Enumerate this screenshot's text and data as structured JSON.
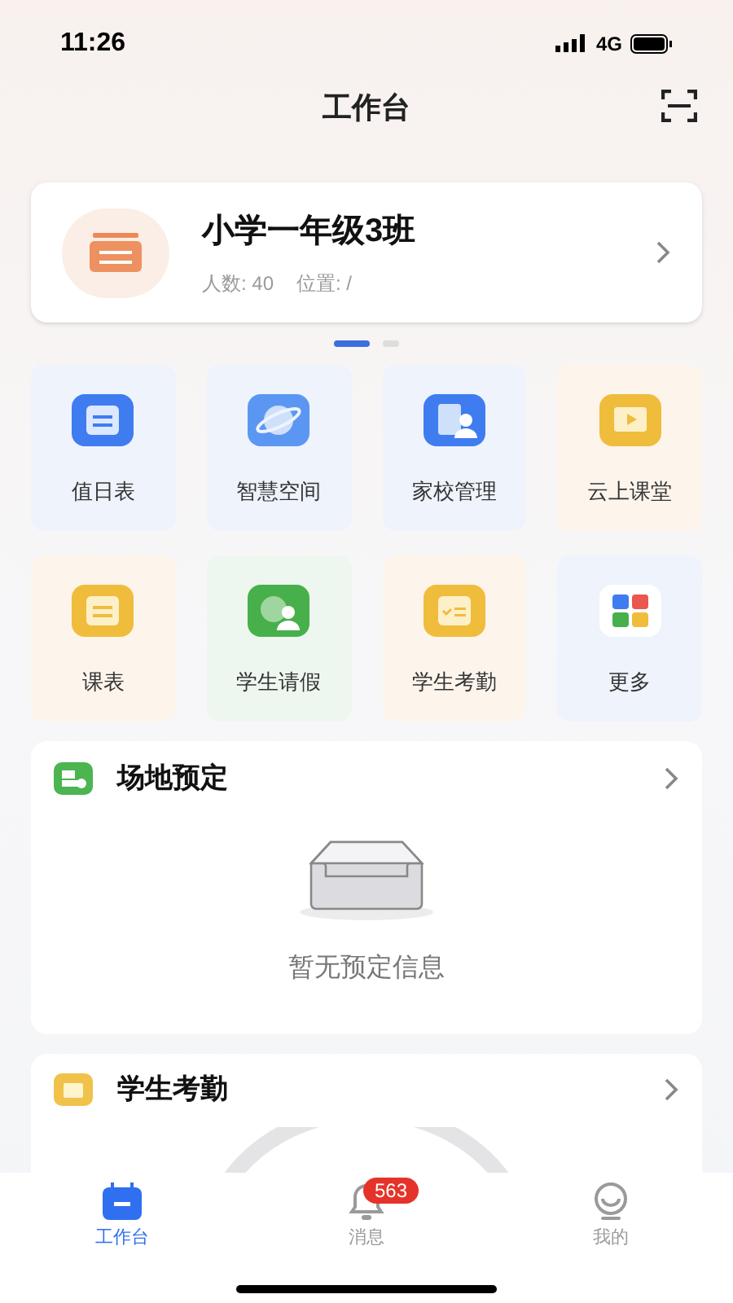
{
  "status_bar": {
    "time": "11:26",
    "network": "4G"
  },
  "header": {
    "title": "工作台"
  },
  "class_card": {
    "name": "小学一年级3班",
    "count_label": "人数: 40",
    "location_label": "位置: /"
  },
  "pager": [
    {
      "selected": true
    },
    {
      "selected": false
    }
  ],
  "tiles": [
    {
      "label": "值日表",
      "color": "#eef3fc"
    },
    {
      "label": "智慧空间",
      "color": "#eef3fc"
    },
    {
      "label": "家校管理",
      "color": "#eef3fc"
    },
    {
      "label": "云上课堂",
      "color": "#fdf5ec"
    },
    {
      "label": "课表",
      "color": "#fdf5ec"
    },
    {
      "label": "学生请假",
      "color": "#eef7ef"
    },
    {
      "label": "学生考勤",
      "color": "#fdf5ec"
    },
    {
      "label": "更多",
      "color": "#eef3fc"
    }
  ],
  "venue_card": {
    "title": "场地预定",
    "empty_text": "暂无预定信息"
  },
  "attendance_card": {
    "title": "学生考勤"
  },
  "tab_bar": [
    {
      "label": "工作台",
      "selected": true
    },
    {
      "label": "消息",
      "selected": false,
      "badge": "563"
    },
    {
      "label": "我的",
      "selected": false
    }
  ]
}
